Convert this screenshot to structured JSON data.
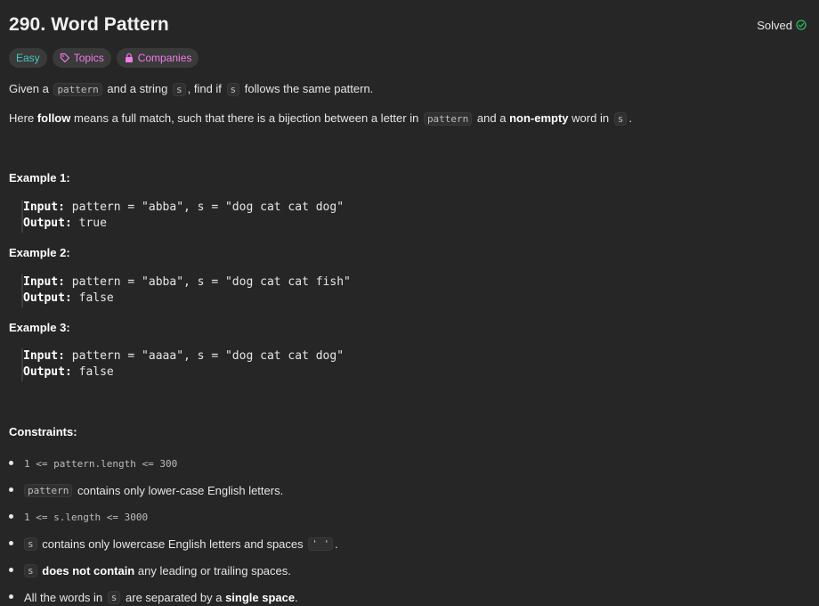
{
  "problem": {
    "title": "290. Word Pattern",
    "status": "Solved"
  },
  "tags": {
    "difficulty": "Easy",
    "topics": "Topics",
    "companies": "Companies"
  },
  "description": {
    "p1": {
      "t1": "Given a",
      "c1": "pattern",
      "t2": "and a string",
      "c2": "s",
      "t3": ", find if",
      "c3": "s",
      "t4": "follows the same pattern."
    },
    "p2": {
      "t1": "Here",
      "b1": "follow",
      "t2": "means a full match, such that there is a bijection between a letter in",
      "c1": "pattern",
      "t3": "and a",
      "b2": "non-empty",
      "t4": "word in",
      "c2": "s",
      "t5": "."
    }
  },
  "examples": [
    {
      "heading": "Example 1:",
      "input_label": "Input:",
      "input_value": " pattern = \"abba\", s = \"dog cat cat dog\"",
      "output_label": "Output:",
      "output_value": " true"
    },
    {
      "heading": "Example 2:",
      "input_label": "Input:",
      "input_value": " pattern = \"abba\", s = \"dog cat cat fish\"",
      "output_label": "Output:",
      "output_value": " false"
    },
    {
      "heading": "Example 3:",
      "input_label": "Input:",
      "input_value": " pattern = \"aaaa\", s = \"dog cat cat dog\"",
      "output_label": "Output:",
      "output_value": " false"
    }
  ],
  "constraints": {
    "heading": "Constraints:",
    "c1": "1 <= pattern.length <= 300",
    "c2": {
      "code": "pattern",
      "text": "contains only lower-case English letters."
    },
    "c3": "1 <= s.length <= 3000",
    "c4": {
      "code": "s",
      "text": "contains only lowercase English letters and spaces",
      "code2": "' '",
      "end": "."
    },
    "c5": {
      "code": "s",
      "bold": "does not contain",
      "text": "any leading or trailing spaces."
    },
    "c6": {
      "t1": "All the words in",
      "code": "s",
      "t2": "are separated by a",
      "bold": "single space",
      "end": "."
    }
  },
  "colors": {
    "background": "#262626",
    "easy": "#46c6c2",
    "tag_accent": "#f07ce8",
    "solved_check": "#2cbb5d"
  }
}
